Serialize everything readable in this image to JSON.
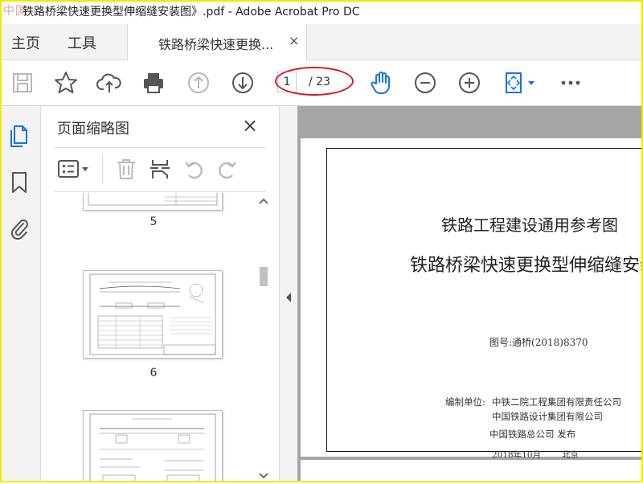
{
  "window": {
    "title": "铁路桥梁快速更换型伸缩缝安装图》.pdf - Adobe Acrobat Pro DC",
    "logo_text": "中国"
  },
  "menu": {
    "home": "主页",
    "tools": "工具",
    "tab_label": "铁路桥梁快速更换...",
    "tab_close": "×"
  },
  "toolbar": {
    "icons": [
      "save-icon",
      "bookmark-star-icon",
      "upload-cloud-icon",
      "print-icon",
      "page-up-icon",
      "page-down-icon",
      "hand-tool-icon",
      "zoom-out-icon",
      "zoom-in-icon",
      "fit-page-icon",
      "more-icon"
    ],
    "current_page": "1",
    "total_pages": "/ 23",
    "accent": "#1473e6",
    "highlight": "#d9181e"
  },
  "rail": {
    "icons": [
      "page-thumbnails-icon",
      "bookmarks-icon",
      "attachments-icon"
    ]
  },
  "thumbnails_panel": {
    "title": "页面缩略图",
    "close": "×",
    "tools": [
      "thumbnail-options-icon",
      "delete-icon",
      "insert-page-icon",
      "rotate-left-icon",
      "rotate-right-icon"
    ],
    "pages": [
      {
        "number": "5"
      },
      {
        "number": "6"
      },
      {
        "number": ""
      }
    ]
  },
  "document": {
    "heading1": "铁路工程建设通用参考图",
    "heading2": "铁路桥梁快速更换型伸缩缝安装",
    "code": "图号:通桥(2018)8370",
    "org_label": "编制单位:",
    "org1": "中铁二院工程集团有限责任公司",
    "org2": "中国铁路设计集团有限公司",
    "publisher": "中国铁路总公司  发布",
    "date": "2018年10月",
    "place": "北京"
  }
}
